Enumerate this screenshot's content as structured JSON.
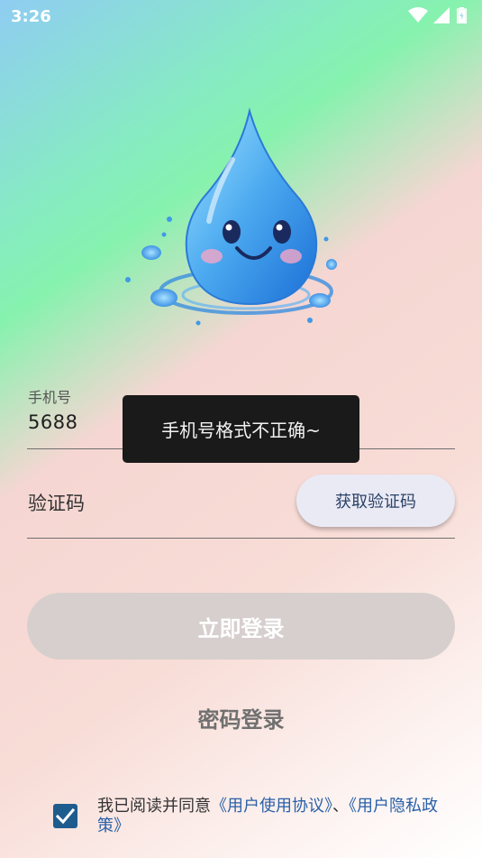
{
  "status_bar": {
    "time": "3:26",
    "icons": [
      "wifi-icon",
      "signal-icon",
      "battery-charging-icon"
    ]
  },
  "logo": {
    "icon": "smiling-water-drop-mascot"
  },
  "form": {
    "phone_label": "手机号",
    "phone_value": "5688",
    "code_placeholder": "验证码",
    "get_code_label": "获取验证码"
  },
  "toast": {
    "message": "手机号格式不正确~"
  },
  "login_button": {
    "label": "立即登录",
    "state": "disabled"
  },
  "password_login": {
    "label": "密码登录"
  },
  "agreement": {
    "checked": true,
    "prefix": "我已阅读并同意",
    "user_agreement": "《用户使用协议》",
    "separator": "、",
    "privacy_policy": "《用户隐私政策》"
  },
  "colors": {
    "link": "#2960a8",
    "checkbox": "#1f5c8e",
    "toast_bg": "#1a1a1a",
    "login_button_bg": "#d6cfcd"
  }
}
